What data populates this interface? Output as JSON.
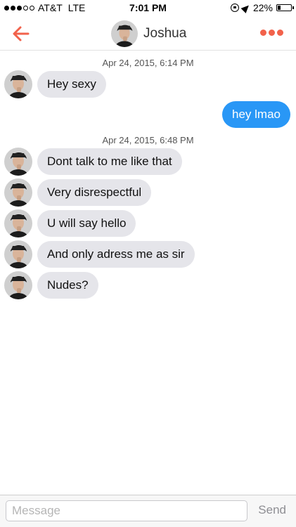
{
  "status_bar": {
    "carrier": "AT&T",
    "network": "LTE",
    "time": "7:01 PM",
    "battery_percent": "22%",
    "battery_level": 0.22,
    "signal_bars_filled": 3,
    "signal_bars_total": 5
  },
  "header": {
    "contact_name": "Joshua",
    "accent_color": "#f2624b",
    "back_icon": "arrow-left-icon",
    "more_icon": "more-dots-icon"
  },
  "conversation": {
    "groups": [
      {
        "timestamp": "Apr 24, 2015, 6:14 PM",
        "messages": [
          {
            "from": "Joshua",
            "text": "Hey sexy"
          },
          {
            "from": "me",
            "text": "hey lmao"
          }
        ]
      },
      {
        "timestamp": "Apr 24, 2015, 6:48 PM",
        "messages": [
          {
            "from": "Joshua",
            "text": "Dont talk to me like that"
          },
          {
            "from": "Joshua",
            "text": "Very disrespectful"
          },
          {
            "from": "Joshua",
            "text": "U will say hello"
          },
          {
            "from": "Joshua",
            "text": "And only adress me as sir"
          },
          {
            "from": "Joshua",
            "text": "Nudes?"
          }
        ]
      }
    ],
    "incoming_bubble_color": "#e5e5ea",
    "outgoing_bubble_color": "#2997f6"
  },
  "composer": {
    "placeholder": "Message",
    "value": "",
    "send_label": "Send"
  }
}
